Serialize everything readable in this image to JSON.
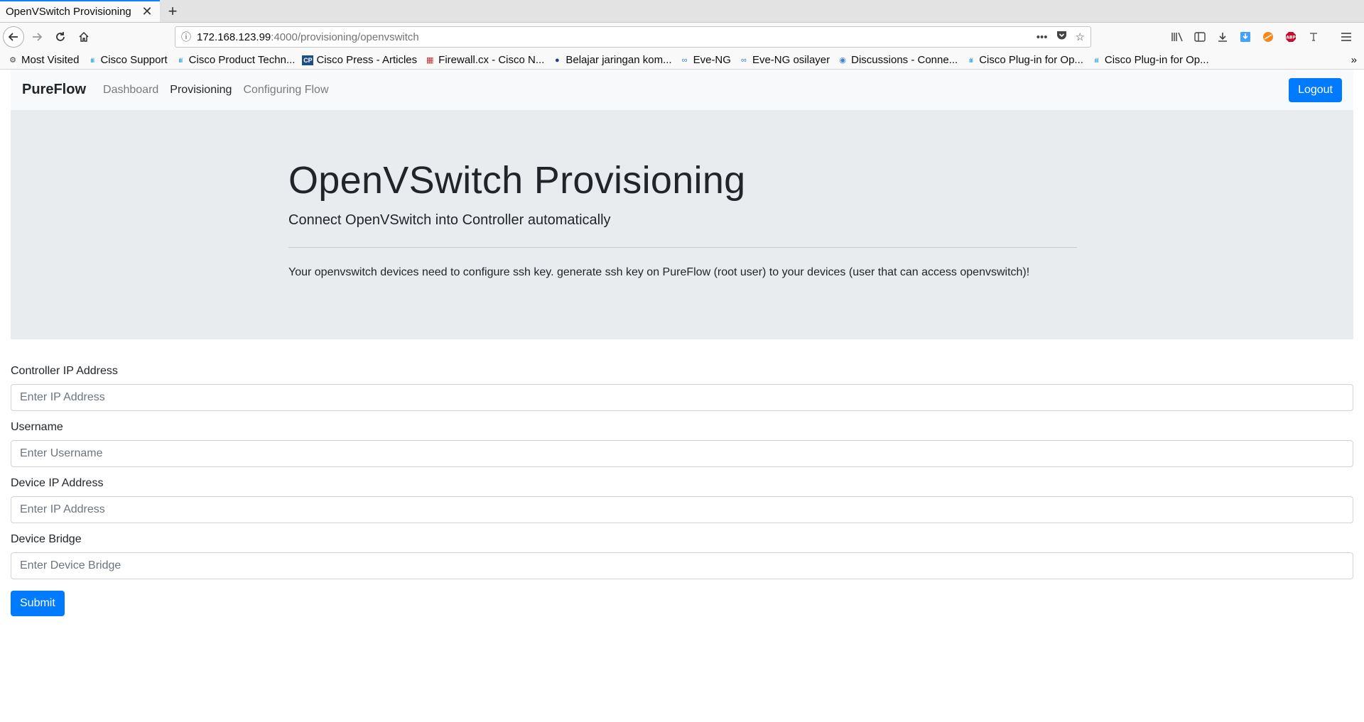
{
  "browser": {
    "tab_title": "OpenVSwitch Provisioning",
    "tab_close": "✕",
    "new_tab": "+",
    "url_host": "172.168.123.99",
    "url_path": ":4000/provisioning/openvswitch",
    "bookmarks": [
      {
        "label": "Most Visited",
        "icon": "gear-icon"
      },
      {
        "label": "Cisco Support",
        "icon": "cisco-icon"
      },
      {
        "label": "Cisco Product Techn...",
        "icon": "cisco-icon"
      },
      {
        "label": "Cisco Press - Articles",
        "icon": "ciscopress-icon"
      },
      {
        "label": "Firewall.cx - Cisco N...",
        "icon": "firewallcx-icon"
      },
      {
        "label": "Belajar jaringan kom...",
        "icon": "globe-icon"
      },
      {
        "label": "Eve-NG",
        "icon": "eveng-icon"
      },
      {
        "label": "Eve-NG osilayer",
        "icon": "eveng-icon"
      },
      {
        "label": "Discussions - Conne...",
        "icon": "discussions-icon"
      },
      {
        "label": "Cisco Plug-in for Op...",
        "icon": "cisco-icon"
      },
      {
        "label": "Cisco Plug-in for Op...",
        "icon": "cisco-icon"
      }
    ],
    "bookmark_more": "»"
  },
  "app": {
    "brand": "PureFlow",
    "nav": [
      "Dashboard",
      "Provisioning",
      "Configuring Flow"
    ],
    "logout": "Logout"
  },
  "jumbotron": {
    "title": "OpenVSwitch Provisioning",
    "lead": "Connect OpenVSwitch into Controller automatically",
    "text": "Your openvswitch devices need to configure ssh key. generate ssh key on PureFlow (root user) to your devices (user that can access openvswitch)!"
  },
  "form": {
    "controller_label": "Controller IP Address",
    "controller_placeholder": "Enter IP Address",
    "username_label": "Username",
    "username_placeholder": "Enter Username",
    "device_ip_label": "Device IP Address",
    "device_ip_placeholder": "Enter IP Address",
    "bridge_label": "Device Bridge",
    "bridge_placeholder": "Enter Device Bridge",
    "submit": "Submit"
  },
  "colors": {
    "primary": "#007bff",
    "jumbotron_bg": "#e9ecef",
    "navbar_bg": "#f8f9fa",
    "tab_accent": "#0a84ff"
  }
}
